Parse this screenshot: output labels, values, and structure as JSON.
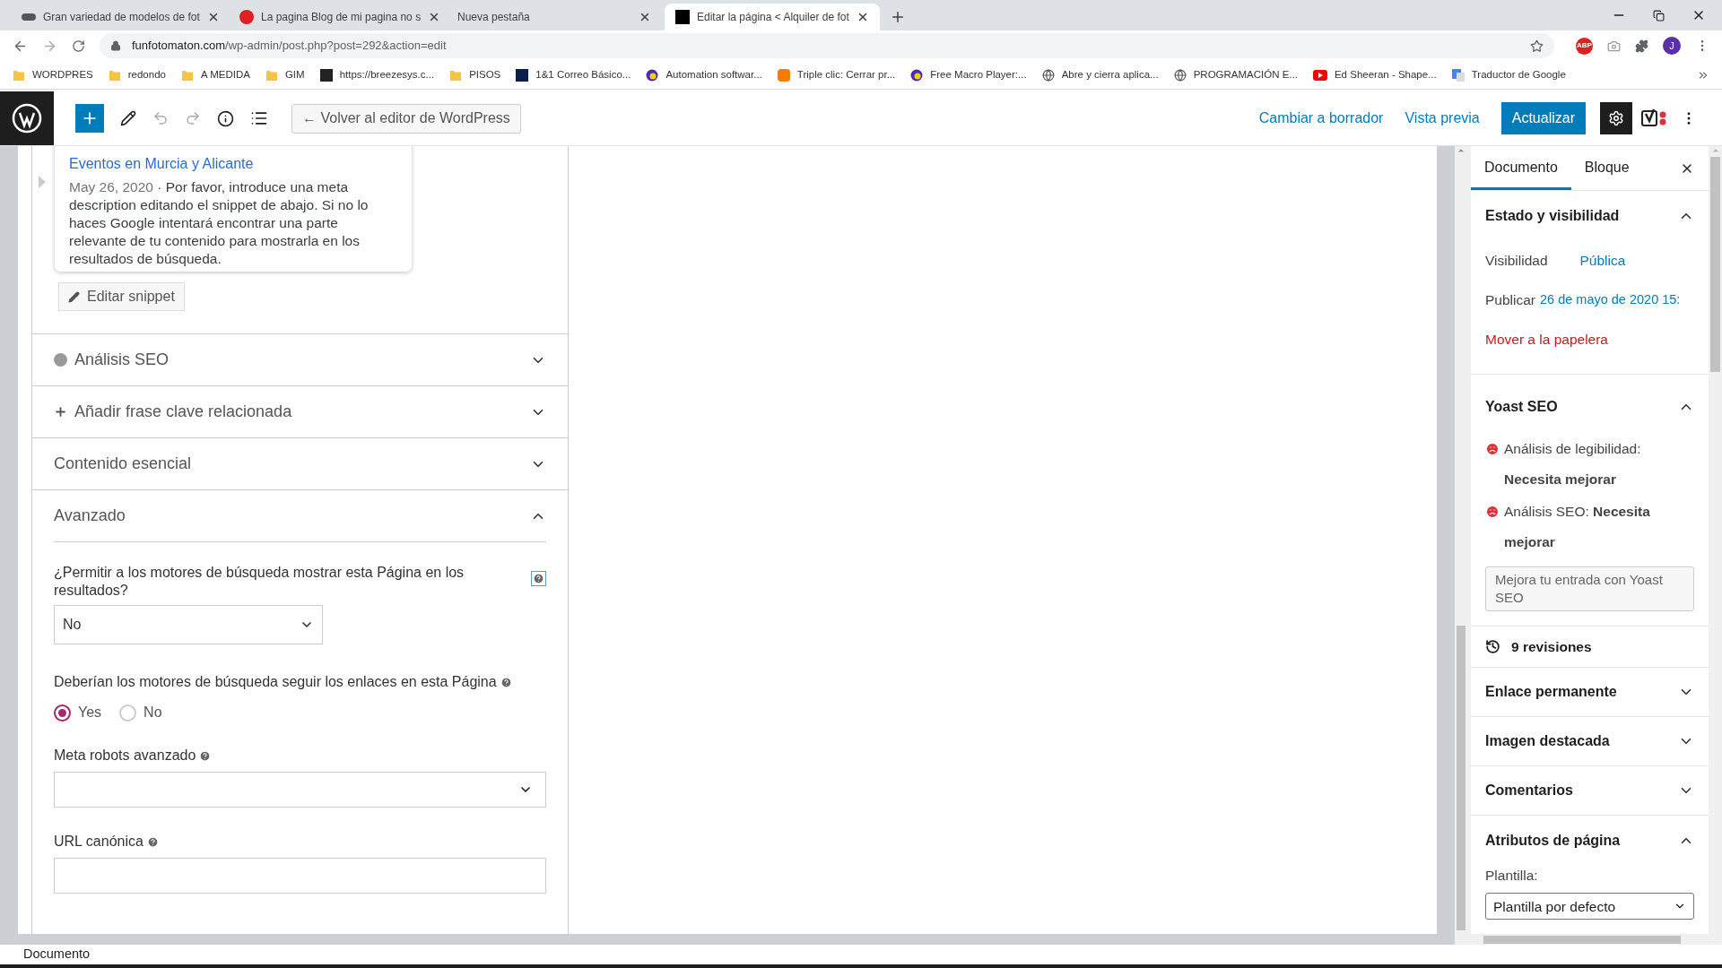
{
  "browser": {
    "tabs": [
      {
        "title": "Gran variedad de modelos de fot",
        "selected": false,
        "kind": "logo"
      },
      {
        "title": "La pagina Blog de mi pagina no s",
        "selected": false,
        "kind": "red"
      },
      {
        "title": "Nueva pestaña",
        "selected": false,
        "kind": "none"
      },
      {
        "title": "Editar la página < Alquiler de fot",
        "selected": true,
        "kind": "black"
      }
    ],
    "address": {
      "domain": "funfotomaton.com",
      "path": "/wp-admin/post.php?post=292&action=edit"
    },
    "extension_badge": "ABP",
    "profile_initial": "J",
    "bookmarks": [
      {
        "label": "WORDPRES",
        "kind": "folder"
      },
      {
        "label": "redondo",
        "kind": "folder"
      },
      {
        "label": "A MEDIDA",
        "kind": "folder"
      },
      {
        "label": "GIM",
        "kind": "folder"
      },
      {
        "label": "https://breezesys.c...",
        "kind": "black"
      },
      {
        "label": "PISOS",
        "kind": "folder"
      },
      {
        "label": "1&1 Correo Básico...",
        "kind": "navy"
      },
      {
        "label": "Automation softwar...",
        "kind": "disc"
      },
      {
        "label": "Triple clic: Cerrar pr...",
        "kind": "orange"
      },
      {
        "label": "Free Macro Player:...",
        "kind": "disc"
      },
      {
        "label": "Abre y cierra aplica...",
        "kind": "globe"
      },
      {
        "label": "PROGRAMACIÓN E...",
        "kind": "globe"
      },
      {
        "label": "Ed Sheeran - Shape...",
        "kind": "video"
      },
      {
        "label": "Traductor de Google",
        "kind": "translate"
      }
    ]
  },
  "toolbar": {
    "back_button": "← Volver al editor de WordPress",
    "links": [
      "Cambiar a borrador",
      "Vista previa"
    ],
    "primary_button": "Actualizar"
  },
  "snippet": {
    "title": "Eventos en Murcia y Alicante",
    "date": "May 26, 2020",
    "description": "· Por favor, introduce una meta description editando el snippet de abajo. Si no lo haces Google intentará encontrar una parte relevante de tu contenido para mostrarla en los resultados de búsqueda.",
    "edit_button": "Editar snippet"
  },
  "sections": [
    {
      "label": "Análisis SEO",
      "kind": "dot",
      "expanded": false
    },
    {
      "label": "Añadir frase clave relacionada",
      "kind": "plus",
      "expanded": false
    },
    {
      "label": "Contenido esencial",
      "kind": "plain",
      "expanded": false
    },
    {
      "label": "Avanzado",
      "kind": "plain",
      "expanded": true
    }
  ],
  "advanced": {
    "index_question": "¿Permitir a los motores de búsqueda mostrar esta Página en los resultados?",
    "index_value": "No",
    "follow_question": "Deberían los motores de búsqueda seguir los enlaces en esta Página",
    "follow_options": [
      {
        "label": "Yes",
        "selected": true
      },
      {
        "label": "No",
        "selected": false
      }
    ],
    "meta_robots_label": "Meta robots avanzado",
    "canonical_label": "URL canónica"
  },
  "sidebar": {
    "tabs": [
      {
        "label": "Documento",
        "selected": true
      },
      {
        "label": "Bloque",
        "selected": false
      }
    ],
    "status": {
      "title": "Estado y visibilidad",
      "expanded": true,
      "visibility_label": "Visibilidad",
      "visibility_value": "Pública",
      "publish_label": "Publicar",
      "publish_value": "26 de mayo de 2020 15:",
      "trash_link": "Mover a la papelera"
    },
    "yoast": {
      "title": "Yoast SEO",
      "expanded": true,
      "results": [
        "Análisis de legibilidad: **Necesita mejorar**",
        "Análisis SEO: **Necesita mejorar**"
      ],
      "button": "Mejora tu entrada con Yoast SEO"
    },
    "revisions": "9 revisiones",
    "panels": [
      {
        "label": "Enlace permanente",
        "expanded": false
      },
      {
        "label": "Imagen destacada",
        "expanded": false
      },
      {
        "label": "Comentarios",
        "expanded": false
      },
      {
        "label": "Atributos de página",
        "expanded": true
      }
    ],
    "template_label": "Plantilla:",
    "template_value": "Plantilla por defecto"
  },
  "footer": "Documento"
}
